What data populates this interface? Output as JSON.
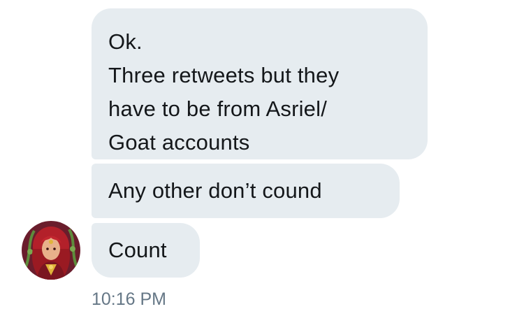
{
  "conversation": {
    "messages": [
      {
        "lines": [
          "Ok.",
          "Three retweets but they",
          "have to be from Asriel/",
          "Goat accounts"
        ]
      },
      {
        "text": "Any other don’t cound"
      },
      {
        "text": "Count"
      }
    ],
    "timestamp": "10:16 PM",
    "sender_avatar": {
      "icon": "sender-avatar-image",
      "colors": {
        "background": "#6a1d2c",
        "hair": "#b3202a",
        "skin": "#e8b08a",
        "accent": "#e0b43a",
        "vine": "#5e8c3c"
      }
    }
  },
  "theme": {
    "bubble_background": "#e6ecf0",
    "text_color": "#14171a",
    "timestamp_color": "#657786"
  }
}
